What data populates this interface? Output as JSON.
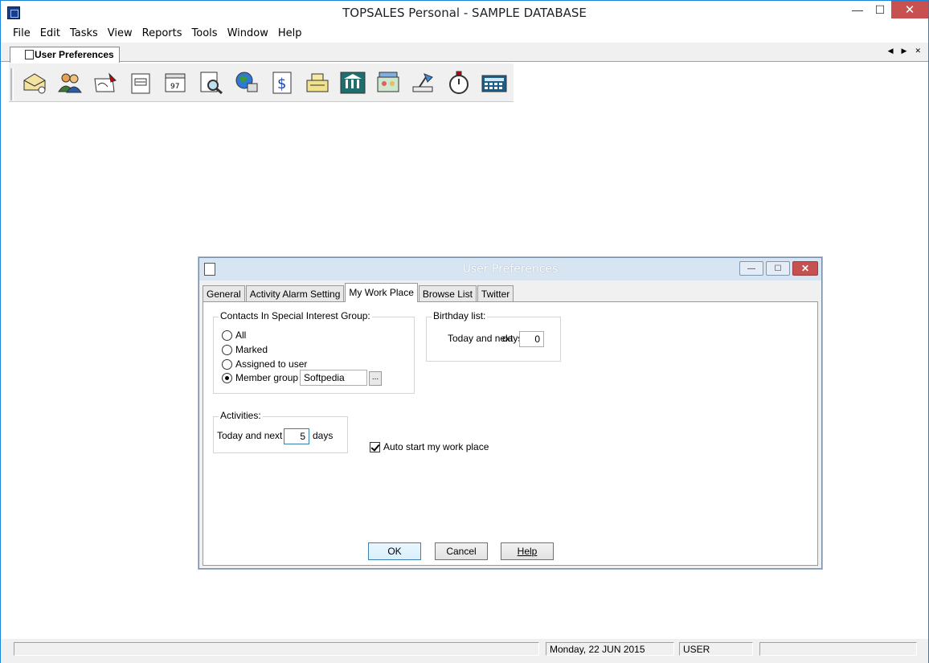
{
  "window": {
    "title": "TOPSALES Personal - SAMPLE DATABASE",
    "minimize": "—",
    "maximize": "☐",
    "close": "✕"
  },
  "menu": [
    "File",
    "Edit",
    "Tasks",
    "View",
    "Reports",
    "Tools",
    "Window",
    "Help"
  ],
  "doc_tab": {
    "label": "User Preferences",
    "prev": "◀",
    "next": "▶",
    "close": "✕"
  },
  "toolbar": [
    "contacts-icon",
    "users-icon",
    "letter-icon",
    "mail-icon",
    "calendar-icon",
    "search-icon",
    "globe-icon",
    "invoice-icon",
    "cash-register-icon",
    "bank-icon",
    "shop-icon",
    "desk-lamp-icon",
    "stopwatch-icon",
    "calculator-icon"
  ],
  "dialog": {
    "title": "User Preferences",
    "tabs": [
      "General",
      "Activity Alarm Setting",
      "My Work Place",
      "Browse List",
      "Twitter"
    ],
    "active_tab": "My Work Place",
    "contacts_group": {
      "legend": "Contacts In Special Interest Group:",
      "options": [
        "All",
        "Marked",
        "Assigned to user",
        "Member group"
      ],
      "selected": "Member group",
      "member_group_value": "Softpedia",
      "browse_label": "..."
    },
    "birthday_group": {
      "legend": "Birthday list:",
      "label": "Today and next",
      "unit": "days",
      "value": "0"
    },
    "activities_group": {
      "legend": "Activities:",
      "label": "Today and next",
      "value": "5",
      "unit": "days"
    },
    "auto_start": {
      "label": "Auto start my work place",
      "checked": true
    },
    "buttons": {
      "ok": "OK",
      "cancel": "Cancel",
      "help": "Help"
    }
  },
  "status": {
    "date": "Monday, 22 JUN 2015",
    "user": "USER"
  }
}
